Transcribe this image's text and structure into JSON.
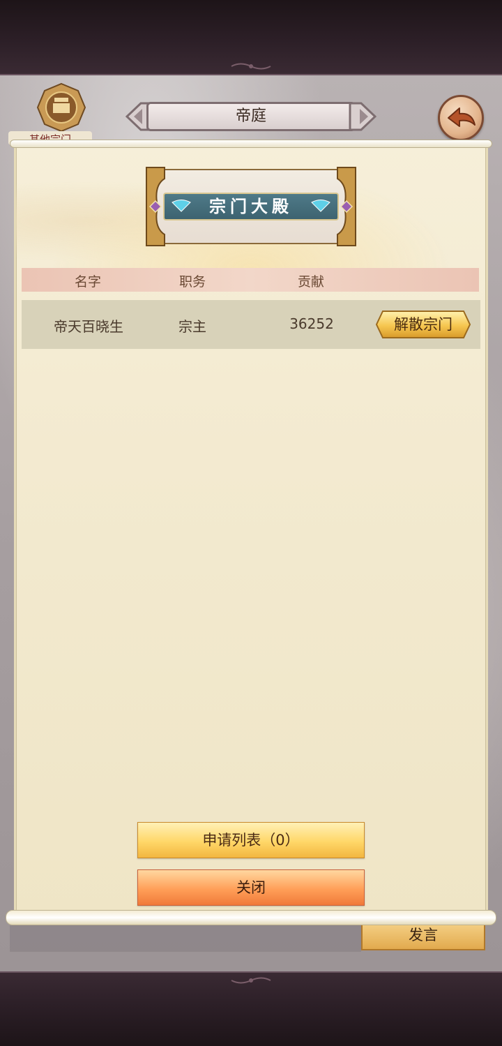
{
  "header": {
    "title": "帝庭",
    "other_sect_label": "其他宗门",
    "back_icon": "back-arrow-icon"
  },
  "banner": {
    "title": "宗门大殿"
  },
  "table": {
    "columns": [
      "名字",
      "职务",
      "贡献"
    ],
    "rows": [
      {
        "name": "帝天百晓生",
        "role": "宗主",
        "contribution": "36252",
        "action": "解散宗门"
      }
    ]
  },
  "footer": {
    "apply_list": "申请列表（0）",
    "close": "关闭",
    "speak": "发言"
  },
  "colors": {
    "accent_gold": "#ffd768",
    "close_orange": "#ff9f58",
    "banner_teal": "#4f7a88"
  }
}
